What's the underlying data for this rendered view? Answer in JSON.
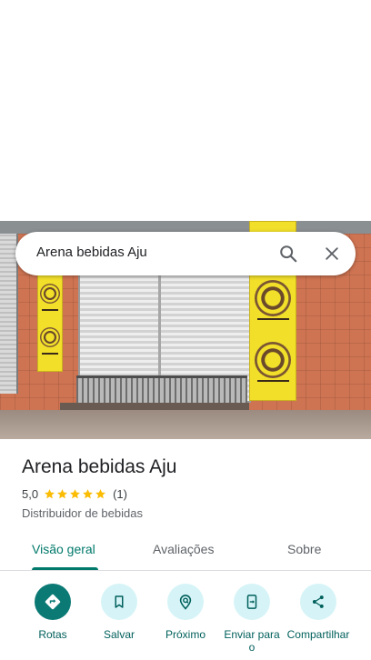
{
  "search": {
    "query": "Arena bebidas Aju"
  },
  "place": {
    "name": "Arena bebidas Aju",
    "rating": "5,0",
    "review_count": "(1)",
    "stars": 5,
    "category": "Distribuidor de bebidas"
  },
  "tabs": [
    {
      "label": "Visão geral",
      "active": true
    },
    {
      "label": "Avaliações",
      "active": false
    },
    {
      "label": "Sobre",
      "active": false
    }
  ],
  "actions": [
    {
      "label": "Rotas",
      "icon": "directions-icon"
    },
    {
      "label": "Salvar",
      "icon": "bookmark-icon"
    },
    {
      "label": "Próximo",
      "icon": "nearby-icon"
    },
    {
      "label": "Enviar para o",
      "icon": "send-to-phone-icon"
    },
    {
      "label": "Compartilhar",
      "icon": "share-icon"
    }
  ],
  "colors": {
    "accent": "#00796b",
    "star": "#fbbc04",
    "primary_button": "#0b7a75",
    "secondary_button": "#d6f4f7"
  }
}
